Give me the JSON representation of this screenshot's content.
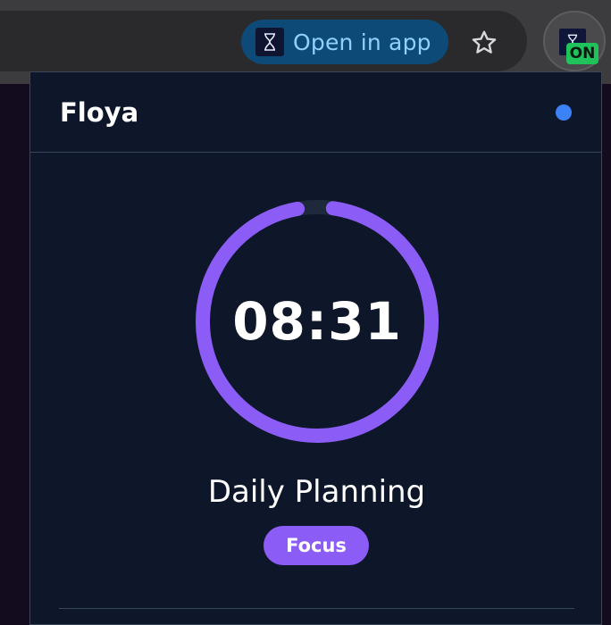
{
  "browser": {
    "open_in_app_label": "Open in app",
    "extension_badge": "ON",
    "icons": {
      "open_app": "hourglass-icon",
      "bookmark": "star-icon",
      "extension": "hourglass-icon"
    }
  },
  "popup": {
    "brand": "Floya",
    "status_color": "#3b82f6",
    "timer": {
      "time": "08:31",
      "progress": 0.95,
      "progress_color": "#8b5cf6",
      "track_color": "#1e293b"
    },
    "session_title": "Daily Planning",
    "mode_badge": "Focus"
  }
}
